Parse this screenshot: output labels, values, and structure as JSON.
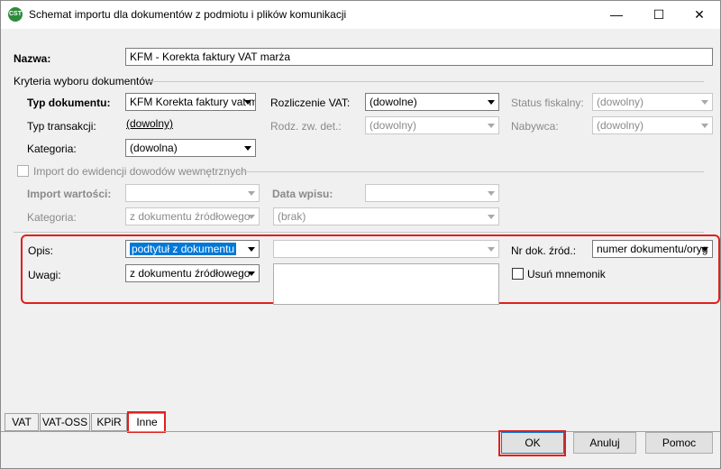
{
  "window": {
    "title": "Schemat importu dla dokumentów z podmiotu i plików komunikacji",
    "icon_name": "comarch-app-icon"
  },
  "name_field": {
    "label": "Nazwa:",
    "value": "KFM - Korekta faktury VAT marża"
  },
  "criteria": {
    "group_label": "Kryteria wyboru dokumentów",
    "doc_type": {
      "label": "Typ dokumentu:",
      "value": "KFM Korekta faktury vat m"
    },
    "vat_settlement": {
      "label": "Rozliczenie VAT:",
      "value": "(dowolne)"
    },
    "fiscal_status": {
      "label": "Status fiskalny:",
      "value": "(dowolny)"
    },
    "transaction_type": {
      "label": "Typ transakcji:",
      "value": "(dowolny)"
    },
    "zw_type": {
      "label": "Rodz. zw. det.:",
      "value": "(dowolny)"
    },
    "buyer": {
      "label": "Nabywca:",
      "value": "(dowolny)"
    },
    "category": {
      "label": "Kategoria:",
      "value": "(dowolna)"
    }
  },
  "internal_import": {
    "checkbox_label": "Import do ewidencji dowodów wewnętrznych",
    "value_import": {
      "label": "Import wartości:",
      "value": ""
    },
    "entry_date": {
      "label": "Data wpisu:",
      "value": ""
    },
    "category": {
      "label": "Kategoria:",
      "value": "z dokumentu źródłowego"
    },
    "category2": {
      "value": "(brak)"
    }
  },
  "details": {
    "description": {
      "label": "Opis:",
      "value": "podtytuł z dokumentu",
      "value2": ""
    },
    "doc_number": {
      "label": "Nr dok. źród.:",
      "value": "numer dokumentu/oryg"
    },
    "notes": {
      "label": "Uwagi:",
      "value": "z dokumentu źródłowego"
    },
    "remove_mnemonic": {
      "label": "Usuń mnemonik"
    }
  },
  "tabs": [
    {
      "label": "VAT"
    },
    {
      "label": "VAT-OSS"
    },
    {
      "label": "KPiR"
    },
    {
      "label": "Inne"
    }
  ],
  "buttons": {
    "ok": "OK",
    "cancel": "Anuluj",
    "help": "Pomoc"
  },
  "colors": {
    "highlight": "#e0201c",
    "selection": "#0078d7"
  }
}
